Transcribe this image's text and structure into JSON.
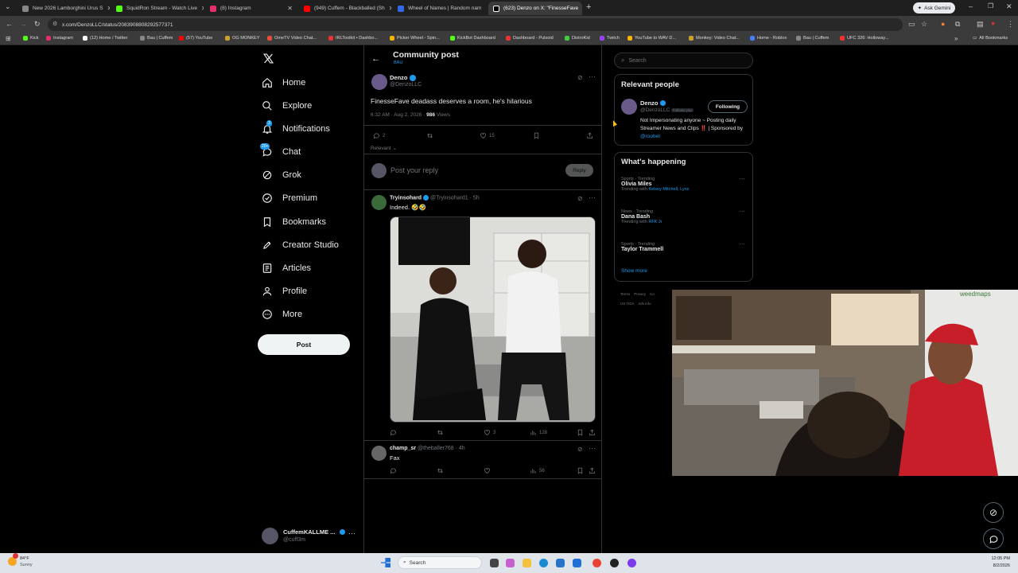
{
  "browser": {
    "tabs": [
      {
        "title": "New 2026 Lamborghini Urus S",
        "color": "#888888"
      },
      {
        "title": "SquidRon Stream - Watch Live",
        "color": "#53fc18"
      },
      {
        "title": "(8) Instagram",
        "color": "#e1306c"
      },
      {
        "title": "(949) Cuffem - Blackballed (Sh",
        "color": "#ff0000"
      },
      {
        "title": "Wheel of Names | Random nam",
        "color": "#3369e8"
      },
      {
        "title": "(623) Denzo on X: \"FinesseFave",
        "color": "#ffffff"
      }
    ],
    "ask_gemini": "Ask Gemini",
    "url": "x.com/DenzoLLC/status/2083908808292577371",
    "bookmarks": [
      {
        "label": "Kick",
        "color": "#53fc18"
      },
      {
        "label": "Instagram",
        "color": "#e1306c"
      },
      {
        "label": "(12) Home / Twitter",
        "color": "#ffffff"
      },
      {
        "label": "Bau | Cuffem",
        "color": "#888888"
      },
      {
        "label": "(57) YouTube",
        "color": "#ff0000"
      },
      {
        "label": "OG MONKEY",
        "color": "#c9a227"
      },
      {
        "label": "OmeTV Video Chat...",
        "color": "#e84c3d"
      },
      {
        "label": "IRLToolkit • Dashbo...",
        "color": "#e33"
      },
      {
        "label": "Picker Wheel - Spin...",
        "color": "#f5b400"
      },
      {
        "label": "KickBot Dashboard",
        "color": "#53fc18"
      },
      {
        "label": "Dashboard - Pulsoid",
        "color": "#e33"
      },
      {
        "label": "DistroKid",
        "color": "#44cc44"
      },
      {
        "label": "Twitch",
        "color": "#9146ff"
      },
      {
        "label": "YouTube to WAV D...",
        "color": "#f5b400"
      },
      {
        "label": "Monkey: Video Chat...",
        "color": "#c9a227"
      },
      {
        "label": "Home - Roblox",
        "color": "#4a7cff"
      },
      {
        "label": "Bau | Cuffem",
        "color": "#888888"
      },
      {
        "label": "UFC 326: Holloway...",
        "color": "#e33"
      }
    ],
    "all_bookmarks": "All Bookmarks"
  },
  "sidebar": {
    "items": [
      {
        "label": "Home",
        "icon": "home-icon"
      },
      {
        "label": "Explore",
        "icon": "search-icon"
      },
      {
        "label": "Notifications",
        "icon": "bell-icon",
        "badge": "3"
      },
      {
        "label": "Chat",
        "icon": "chat-icon",
        "badge": "20+"
      },
      {
        "label": "Grok",
        "icon": "grok-icon"
      },
      {
        "label": "Premium",
        "icon": "premium-icon"
      },
      {
        "label": "Bookmarks",
        "icon": "bookmark-icon"
      },
      {
        "label": "Creator Studio",
        "icon": "rocket-icon"
      },
      {
        "label": "Articles",
        "icon": "article-icon"
      },
      {
        "label": "Profile",
        "icon": "person-icon"
      },
      {
        "label": "More",
        "icon": "more-icon"
      }
    ],
    "post_label": "Post",
    "account": {
      "name": "CuffemKALLME ...",
      "handle": "@cuff3m"
    }
  },
  "header": {
    "title": "Community post",
    "subtitle": "BAU"
  },
  "post": {
    "author": "Denzo",
    "handle": "@DenzoLLC",
    "text": "FinesseFave deadass deserves a room, he's hilarious",
    "time": "6:32 AM · Aug 2, 2026 · ",
    "views": "986",
    "views_label": " Views",
    "replies": "2",
    "likes": "15",
    "sort": "Relevant"
  },
  "composer": {
    "placeholder": "Post your reply",
    "button": "Reply"
  },
  "replies": [
    {
      "author": "Tryinsohard",
      "handle": "@Tryinsohard1 · 5h",
      "text": "Indeed. 🤣🤣",
      "likes": "3",
      "views": "128"
    },
    {
      "author": "champ_sr",
      "handle": "@theballer768 · 4h",
      "text": "Fax",
      "views": "56"
    }
  ],
  "right": {
    "search_placeholder": "Search",
    "relevant_title": "Relevant people",
    "person": {
      "name": "Denzo",
      "handle": "@DenzoLLC",
      "follows_you": "Follows you",
      "button": "Following",
      "bio": "Not Impersonating anyone ~ Posting daily Streamer News and Clips ‼️ | Sponsored by ",
      "bio_link": "@roobet"
    },
    "happening_title": "What's happening",
    "trends": [
      {
        "category": "Sports · Trending",
        "name": "Olivia Miles",
        "with_label": "Trending with ",
        "with": "Kelsey Mitchell, Lynx"
      },
      {
        "category": "News · Trending",
        "name": "Dana Bash",
        "with_label": "Trending with ",
        "with": "RFK Jr"
      },
      {
        "category": "Sports · Trending",
        "name": "Taylor Trammell",
        "with_label": "",
        "with": ""
      }
    ],
    "show_more": "Show more",
    "footer": [
      "Terms",
      "Privacy",
      "Co",
      "US TIDA",
      "Ads info"
    ]
  },
  "taskbar": {
    "weather_temp": "84°F",
    "weather_text": "Sunny",
    "search": "Search",
    "time": "12:05 PM",
    "date": "8/2/2026"
  },
  "colors": {
    "accent": "#1d9bf0",
    "bg": "#000000",
    "border": "#2f3336",
    "muted": "#71767b"
  }
}
